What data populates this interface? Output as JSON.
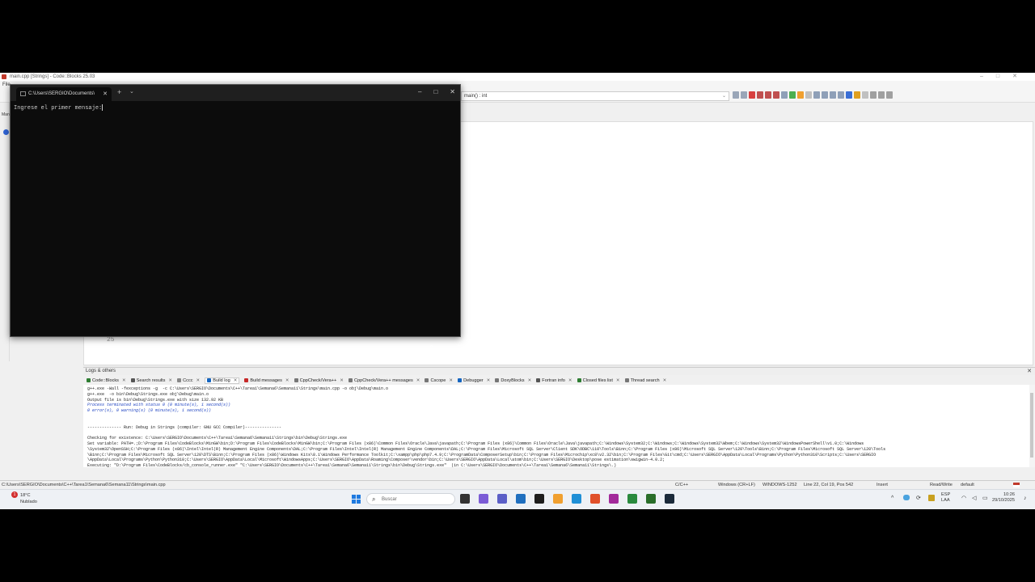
{
  "ide": {
    "title": "main.cpp [Strings] - Code::Blocks 25.03",
    "menu_label": "File",
    "mgmt_label": "Man",
    "function_selector": "main() : int",
    "editor_line_number": "25"
  },
  "console": {
    "tab_title": "C:\\Users\\SERGIO\\Documents\\",
    "prompt_text": "Ingrese el primer mensaje:"
  },
  "logs": {
    "header": "Logs & others",
    "tabs": [
      {
        "label": "Code::Blocks",
        "color": "#2e7d32"
      },
      {
        "label": "Search results",
        "color": "#555555"
      },
      {
        "label": "Cccc",
        "color": "#888888"
      },
      {
        "label": "Build log",
        "color": "#1565c0"
      },
      {
        "label": "Build messages",
        "color": "#c62828"
      },
      {
        "label": "CppCheck/Vera++",
        "color": "#777777"
      },
      {
        "label": "CppCheck/Vera++ messages",
        "color": "#777777"
      },
      {
        "label": "Cscope",
        "color": "#777777"
      },
      {
        "label": "Debugger",
        "color": "#1565c0"
      },
      {
        "label": "DoxyBlocks",
        "color": "#777777"
      },
      {
        "label": "Fortran info",
        "color": "#555555"
      },
      {
        "label": "Closed files list",
        "color": "#2e7d32"
      },
      {
        "label": "Thread search",
        "color": "#777777"
      }
    ],
    "lines": [
      "g++.exe -Wall -fexceptions -g  -c C:\\Users\\SERGIO\\Documents\\C++\\Tarea1\\Semana6\\Semana11\\Strings\\main.cpp -o obj\\Debug\\main.o",
      "g++.exe  -o bin\\Debug\\Strings.exe obj\\Debug\\main.o",
      "Output file is bin\\Debug\\Strings.exe with size 132.92 KB",
      "Process terminated with status 0 (0 minute(s), 1 second(s))",
      "0 error(s), 0 warning(s) (0 minute(s), 1 second(s))",
      "",
      "",
      "-------------- Run: Debug in Strings (compiler: GNU GCC Compiler)---------------",
      "",
      "Checking for existence: C:\\Users\\SERGIO\\Documents\\C++\\Tarea1\\Semana6\\Semana11\\Strings\\bin\\Debug\\Strings.exe",
      "Set variable: PATH=.;D:\\Program Files\\CodeBlocks\\MinGW\\bin;D:\\Program Files\\CodeBlocks\\MinGW\\bin;C:\\Program Files (x86)\\Common Files\\Oracle\\Java\\javapath;C:\\Program Files (x86)\\Common Files\\Oracle\\Java\\javapath;C:\\Windows\\System32;C:\\Windows;C:\\Windows\\System32\\Wbem;C:\\Windows\\System32\\WindowsPowerShell\\v1.0;C:\\Windows",
      "\\System32\\OpenSSH;C:\\Program Files (x86)\\Intel\\Intel(R) Management Engine Components\\DAL;C:\\Program Files\\Intel\\Intel(R) Management Engine Components\\DAL;C:\\Program Files\\Microsoft SQL Server\\Client SDK\\ODBC\\110\\Tools\\Binn;C:\\Program Files (x86)\\Microsoft SQL Server\\120\\Tools\\Binn;C:\\Program Files\\Microsoft SQL Server\\120\\Tools",
      "\\Binn;C:\\Program Files\\Microsoft SQL Server\\120\\DTS\\Binn;C:\\Program Files (x86)\\Windows Kits\\8.1\\Windows Performance Toolkit;C:\\xampp\\php\\php7.4.9;C:\\ProgramData\\ComposerSetup\\bin;C:\\Program Files\\Microchip\\xc8\\v2.32\\bin;C:\\Program Files\\Git\\cmd;C:\\Users\\SERGIO\\AppData\\Local\\Programs\\Python\\Python310\\Scripts;C:\\Users\\SERGIO",
      "\\AppData\\Local\\Programs\\Python\\Python310;C:\\Users\\SERGIO\\AppData\\Local\\Microsoft\\WindowsApps;C:\\Users\\SERGIO\\AppData\\Roaming\\Composer\\vendor\\bin;C:\\Users\\SERGIO\\AppData\\Local\\atom\\bin;C:\\Users\\SERGIO\\Desktop\\pose estimation\\swigwin-4.0.2;",
      "Executing: \"D:\\Program Files\\CodeBlocks/cb_console_runner.exe\" \"C:\\Users\\SERGIO\\Documents\\C++\\Tarea1\\Semana6\\Semana11\\Strings\\bin\\Debug\\Strings.exe\"  (in C:\\Users\\SERGIO\\Documents\\C++\\Tarea1\\Semana6\\Semana11\\Strings\\.)"
    ]
  },
  "status": {
    "filepath": "C:\\Users\\SERGIO\\Documents\\C++\\Tarea1\\Semana6\\Semana11\\Strings\\main.cpp",
    "language": "C/C++",
    "eol": "Windows (CR+LF)",
    "encoding": "WINDOWS-1252",
    "position": "Line 22, Col 19, Pos 542",
    "mode": "Insert",
    "access": "Read/Write",
    "profile": "default"
  },
  "taskbar": {
    "weather_temp": "18°C",
    "weather_desc": "Nublado",
    "weather_badge": "1",
    "search_placeholder": "Buscar",
    "lang": "ESP",
    "lang_sub": "LAA",
    "time": "10:26",
    "date": "29/10/2025"
  }
}
